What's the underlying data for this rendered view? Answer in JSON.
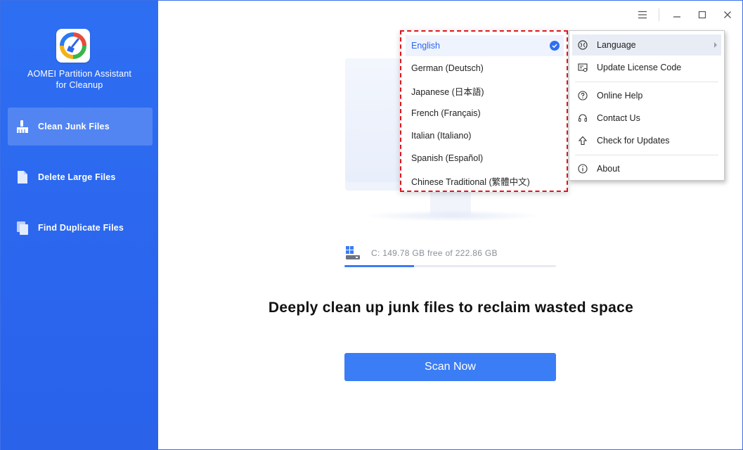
{
  "app": {
    "title_line1": "AOMEI Partition Assistant",
    "title_line2": "for Cleanup"
  },
  "sidebar": {
    "items": [
      {
        "label": "Clean Junk Files",
        "icon": "broom-icon",
        "active": true
      },
      {
        "label": "Delete Large Files",
        "icon": "file-icon",
        "active": false
      },
      {
        "label": "Find Duplicate Files",
        "icon": "duplicate-files-icon",
        "active": false
      }
    ]
  },
  "titlebar": {
    "menu_icon": "hamburger-icon",
    "minimize_icon": "minimize-icon",
    "maximize_icon": "maximize-icon",
    "close_icon": "close-icon"
  },
  "drive": {
    "label": "C: 149.78 GB free of 222.86 GB",
    "used_fraction": 0.33
  },
  "main": {
    "headline": "Deeply clean up junk files to reclaim wasted space",
    "scan_button": "Scan Now"
  },
  "main_menu": {
    "items": [
      {
        "label": "Language",
        "icon": "globe-icon"
      },
      {
        "label": "Update License Code",
        "icon": "license-icon"
      },
      {
        "label": "Online Help",
        "icon": "help-icon"
      },
      {
        "label": "Contact Us",
        "icon": "headset-icon"
      },
      {
        "label": "Check for Updates",
        "icon": "upload-arrow-icon"
      },
      {
        "label": "About",
        "icon": "info-icon"
      }
    ]
  },
  "language_menu": {
    "selected": "English",
    "items": [
      "English",
      "German (Deutsch)",
      "Japanese (日本語)",
      "French (Français)",
      "Italian (Italiano)",
      "Spanish (Español)",
      "Chinese Traditional (繁體中文)"
    ]
  },
  "colors": {
    "sidebar": "#2e6ff2",
    "accent": "#3a7df5",
    "highlight_border": "#e0141c"
  }
}
